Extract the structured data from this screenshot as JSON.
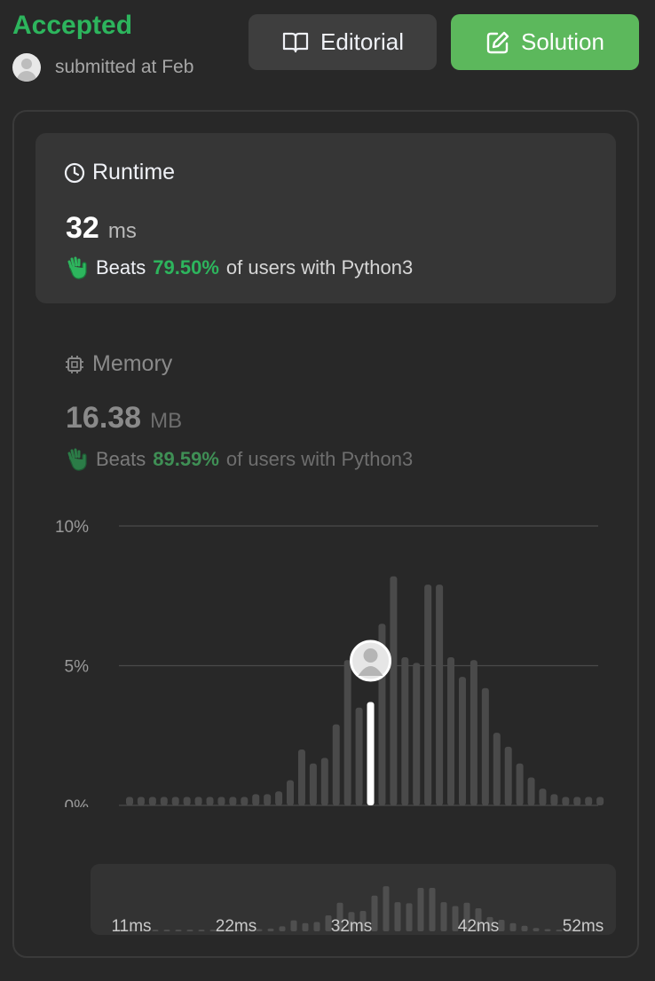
{
  "header": {
    "status": "Accepted",
    "submitted_text": "submitted at Feb",
    "editorial_label": "Editorial",
    "solution_label": "Solution"
  },
  "runtime": {
    "title": "Runtime",
    "value": "32",
    "unit": "ms",
    "beats_label": "Beats",
    "percent": "79.50%",
    "suffix": "of users with Python3"
  },
  "memory": {
    "title": "Memory",
    "value": "16.38",
    "unit": "MB",
    "beats_label": "Beats",
    "percent": "89.59%",
    "suffix": "of users with Python3"
  },
  "colors": {
    "accent_green": "#2db55d",
    "solution_button": "#5cb85c",
    "bar_gray": "#4a4a4a",
    "highlight_bar": "#ffffff"
  },
  "chart_data": [
    {
      "type": "bar",
      "title": "",
      "x_tick_labels": [
        "11ms",
        "32ms",
        "52ms"
      ],
      "y_tick_labels": [
        "0%",
        "5%",
        "10%"
      ],
      "ylim": [
        0,
        10
      ],
      "y_unit": "%",
      "categories_ms": [
        11,
        12,
        13,
        14,
        15,
        16,
        17,
        18,
        19,
        20,
        21,
        22,
        23,
        24,
        25,
        26,
        27,
        28,
        29,
        30,
        31,
        32,
        33,
        34,
        35,
        36,
        37,
        38,
        39,
        40,
        41,
        42,
        43,
        44,
        45,
        46,
        47,
        48,
        49,
        50,
        51,
        52
      ],
      "values": [
        0.3,
        0.3,
        0.3,
        0.3,
        0.3,
        0.3,
        0.3,
        0.3,
        0.3,
        0.3,
        0.3,
        0.4,
        0.4,
        0.5,
        0.9,
        2.0,
        1.5,
        1.7,
        2.9,
        5.2,
        3.5,
        3.7,
        6.5,
        8.2,
        5.3,
        5.1,
        7.9,
        7.9,
        5.3,
        4.6,
        5.2,
        4.2,
        2.6,
        2.1,
        1.5,
        1.0,
        0.6,
        0.4,
        0.3,
        0.3,
        0.3,
        0.3
      ],
      "highlight_ms": 32,
      "grid": true
    },
    {
      "type": "bar",
      "title": "",
      "x_tick_labels": [
        "11ms",
        "22ms",
        "32ms",
        "42ms",
        "52ms"
      ],
      "values": [
        0.3,
        0.3,
        0.3,
        0.3,
        0.3,
        0.3,
        0.3,
        0.3,
        0.3,
        0.3,
        0.3,
        0.4,
        0.4,
        0.5,
        0.9,
        2.0,
        1.5,
        1.7,
        2.9,
        5.2,
        3.5,
        3.7,
        6.5,
        8.2,
        5.3,
        5.1,
        7.9,
        7.9,
        5.3,
        4.6,
        5.2,
        4.2,
        2.6,
        2.1,
        1.5,
        1.0,
        0.6,
        0.4,
        0.3,
        0.3,
        0.3,
        0.3
      ],
      "ylim": [
        0,
        10
      ]
    }
  ]
}
